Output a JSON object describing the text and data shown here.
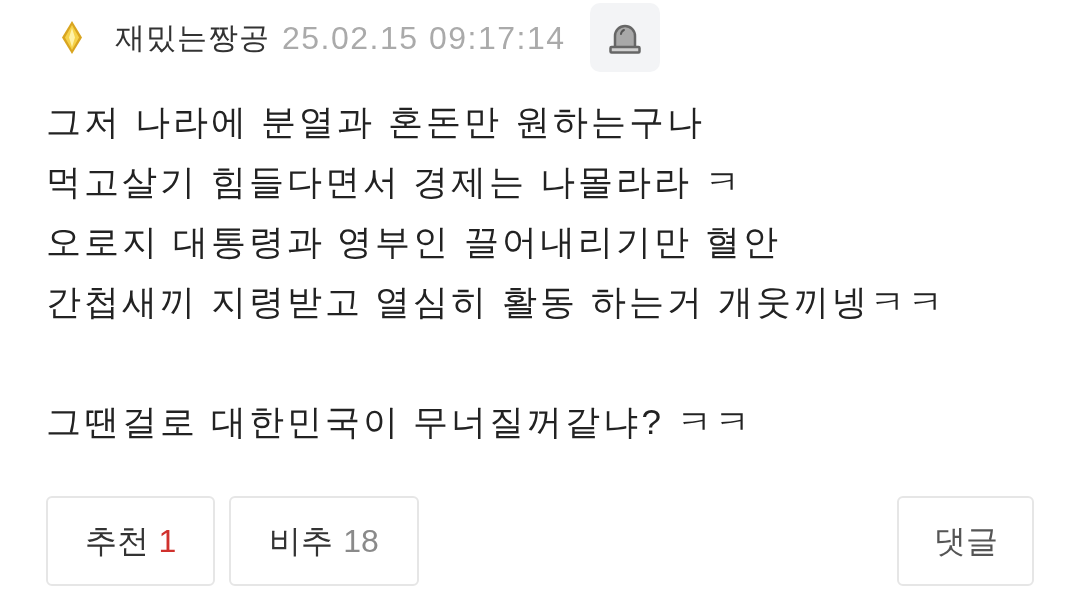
{
  "author": {
    "name": "재밌는짱공",
    "timestamp": "25.02.15 09:17:14"
  },
  "paragraphs": [
    {
      "lines": [
        "그저 나라에 분열과 혼돈만 원하는구나",
        "먹고살기 힘들다면서 경제는 나몰라라 ㅋ",
        "오로지 대통령과 영부인 끌어내리기만 혈안",
        "간첩새끼 지령받고 열심히 활동 하는거 개웃끼넹ㅋㅋ"
      ]
    },
    {
      "lines": [
        "그땐걸로 대한민국이 무너질꺼같냐? ㅋㅋ"
      ]
    }
  ],
  "vote_buttons": [
    {
      "kind": "up",
      "label": "추천",
      "count": "1"
    },
    {
      "kind": "down",
      "label": "비추",
      "count": "18"
    }
  ],
  "reply_button": {
    "label": "댓글"
  }
}
